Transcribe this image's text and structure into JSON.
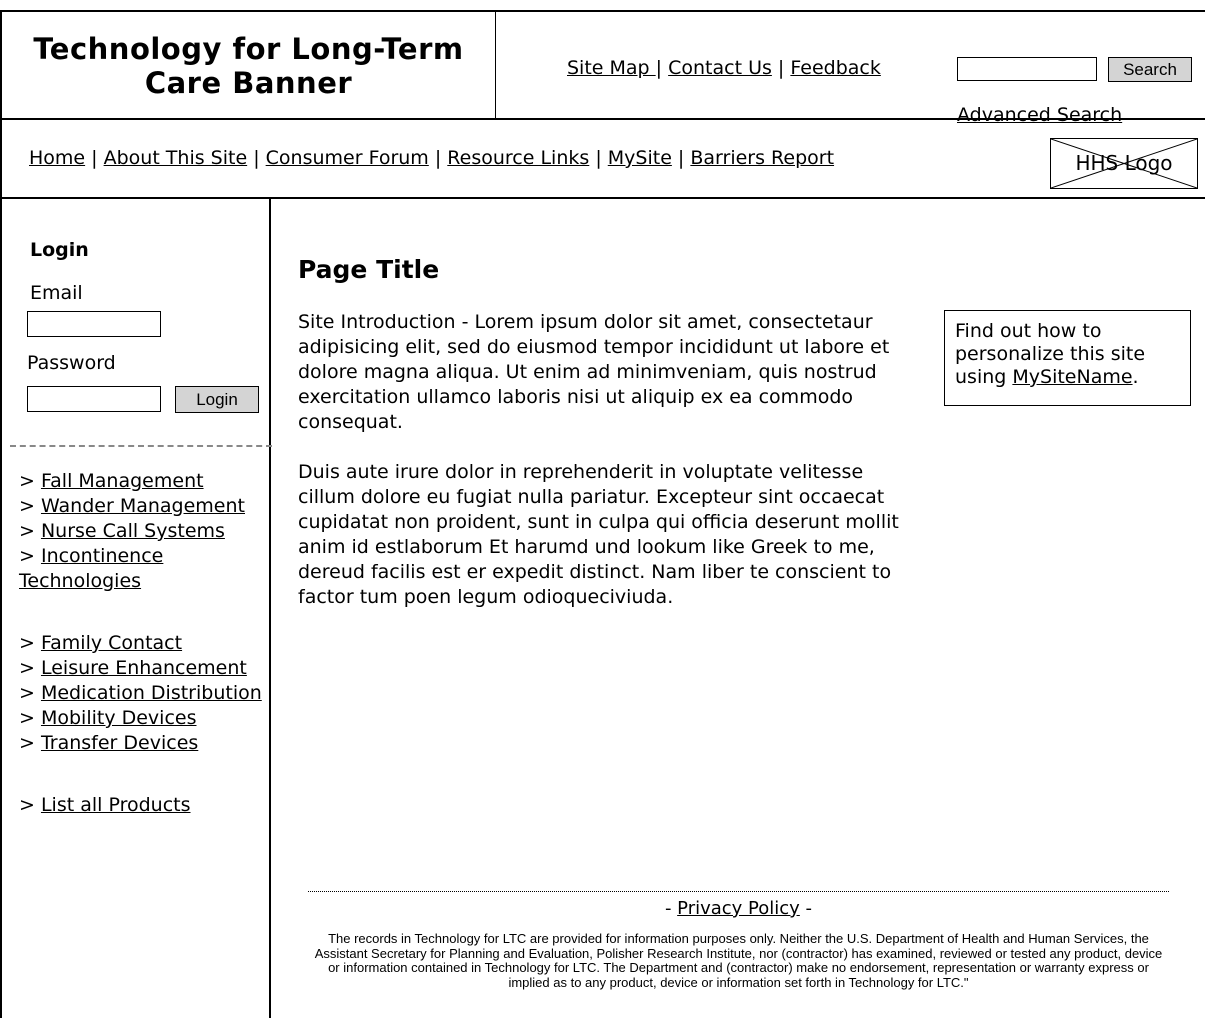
{
  "header": {
    "banner_title": "Technology for Long-Term Care Banner",
    "links": [
      "Site Map ",
      "Contact Us",
      "Feedback"
    ],
    "search": {
      "input_value": "",
      "button_label": "Search",
      "advanced_label": "Advanced Search"
    }
  },
  "nav": {
    "links": [
      "Home",
      "About This Site",
      "Consumer Forum",
      "Resource Links",
      "MySite",
      "Barriers Report"
    ],
    "logo_label": "HHS Logo"
  },
  "sidebar": {
    "login_title": "Login",
    "email_label": "Email",
    "password_label": "Password",
    "login_button": "Login",
    "group1": [
      "Fall Management",
      "Wander Management",
      "Nurse Call Systems",
      "Incontinence Technologies"
    ],
    "group2": [
      "Family Contact",
      "Leisure Enhancement",
      "Medication Distribution",
      "Mobility Devices",
      "Transfer Devices"
    ],
    "group3": [
      "List all Products"
    ],
    "bullet": "> "
  },
  "main": {
    "page_title": "Page Title",
    "intro": "Site Introduction - Lorem ipsum dolor sit amet, consectetaur adipisicing elit, sed do eiusmod tempor incididunt ut labore et dolore magna aliqua. Ut enim ad minimveniam, quis nostrud exercitation ullamco laboris nisi ut aliquip ex ea commodo consequat.",
    "body": "Duis aute irure dolor in reprehenderit in voluptate velitesse cillum dolore eu fugiat nulla pariatur. Excepteur sint occaecat cupidatat non proident, sunt in culpa qui officia deserunt mollit anim id estlaborum Et harumd und lookum like Greek to me, dereud facilis est er expedit distinct. Nam liber te conscient to factor tum poen legum odioqueciviuda.",
    "promo_prefix": "Find out how to personalize this site using ",
    "promo_link": "MySiteName",
    "promo_suffix": "."
  },
  "footer": {
    "privacy_prefix": "- ",
    "privacy_link": "Privacy Policy",
    "privacy_suffix": " -",
    "disclaimer": "The records in Technology for LTC are provided for information purposes only. Neither the U.S. Department of Health and Human Services, the Assistant Secretary for Planning and Evaluation, Polisher Research Institute, nor (contractor) has examined, reviewed or tested any product, device or information contained in Technology for LTC. The Department and (contractor) make no endorsement, representation or warranty express or implied as to any product, device or information set forth in Technology for LTC.\""
  }
}
